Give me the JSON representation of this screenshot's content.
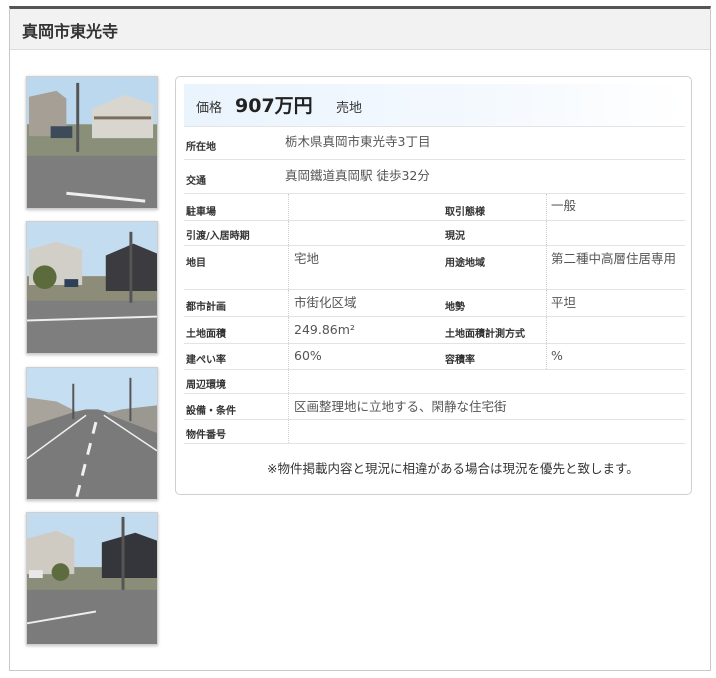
{
  "title": "真岡市東光寺",
  "photos": [
    {
      "icon": "property-photo-1",
      "alt": "street-view-1"
    },
    {
      "icon": "property-photo-2",
      "alt": "street-view-2"
    },
    {
      "icon": "property-photo-3",
      "alt": "street-view-3"
    },
    {
      "icon": "property-photo-4",
      "alt": "street-view-4"
    }
  ],
  "price": {
    "label": "価格",
    "value": "907万円",
    "type": "売地"
  },
  "address": {
    "label": "所在地",
    "value": "栃木県真岡市東光寺3丁目"
  },
  "access": {
    "label": "交通",
    "value": "真岡鐵道真岡駅 徒歩32分"
  },
  "details": {
    "parking": {
      "label": "駐車場",
      "value": ""
    },
    "transaction": {
      "label": "取引態様",
      "value": "一般"
    },
    "handover": {
      "label": "引渡/入居時期",
      "value": ""
    },
    "status": {
      "label": "現況",
      "value": ""
    },
    "land_category": {
      "label": "地目",
      "value": "宅地"
    },
    "zoning": {
      "label": "用途地域",
      "value": "第二種中高層住居専用"
    },
    "city_planning": {
      "label": "都市計画",
      "value": "市街化区域"
    },
    "terrain": {
      "label": "地勢",
      "value": "平坦"
    },
    "land_area": {
      "label": "土地面積",
      "value": "249.86m²"
    },
    "area_method": {
      "label": "土地面積計測方式",
      "value": ""
    },
    "coverage": {
      "label": "建ぺい率",
      "value": "60%"
    },
    "floor_ratio": {
      "label": "容積率",
      "value": "%"
    },
    "surroundings": {
      "label": "周辺環境",
      "value": ""
    },
    "facilities": {
      "label": "設備・条件",
      "value": "区画整理地に立地する、閑静な住宅街"
    },
    "property_number": {
      "label": "物件番号",
      "value": ""
    }
  },
  "note": "※物件掲載内容と現況に相違がある場合は現況を優先と致します。"
}
